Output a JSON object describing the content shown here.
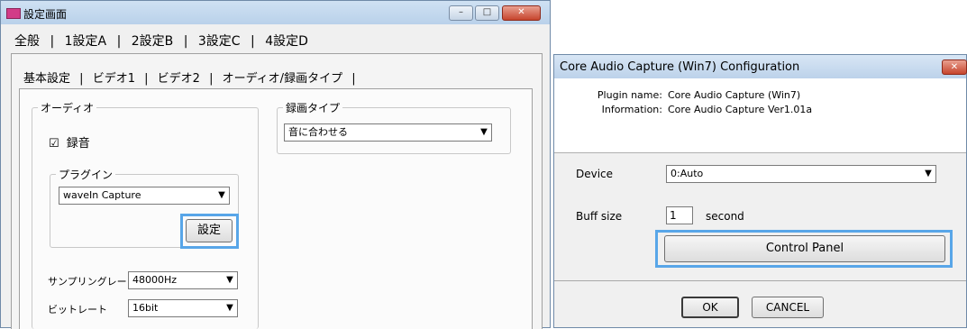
{
  "settings_window": {
    "title": "設定画面",
    "controls": {
      "minimize": "–",
      "maximize": "□",
      "close": "✕"
    },
    "top_tabs": [
      "全般",
      "1設定A",
      "2設定B",
      "3設定C",
      "4設定D"
    ],
    "top_tab_separators": [
      "|",
      "|",
      "|",
      "|"
    ],
    "sub_tabs": [
      "基本設定",
      "ビデオ1",
      "ビデオ2",
      "オーディオ/録画タイプ"
    ],
    "sub_tab_separators": [
      "|",
      "|",
      "|",
      "|"
    ],
    "audio_group": {
      "legend": "オーディオ",
      "record_checkbox": {
        "mark": "☑",
        "label": "録音",
        "checked": true
      },
      "plugin_group": {
        "legend": "プラグイン",
        "plugin_select": "waveIn Capture",
        "settings_button": "設定"
      },
      "sampling_rate_label": "サンプリングレート",
      "sampling_rate_value": "48000Hz",
      "bit_rate_label": "ビットレート",
      "bit_rate_value": "16bit"
    },
    "record_type_group": {
      "legend": "録画タイプ",
      "record_type_select": "音に合わせる"
    }
  },
  "config_dialog": {
    "title": "Core Audio Capture (Win7) Configuration",
    "close": "✕",
    "plugin_name_label": "Plugin name:",
    "plugin_name_value": "Core Audio Capture (Win7)",
    "information_label": "Information:",
    "information_value": "Core Audio Capture Ver1.01a",
    "device_label": "Device",
    "device_value": "0:Auto",
    "buff_size_label": "Buff size",
    "buff_size_value": "1",
    "buff_size_unit": "second",
    "control_panel_button": "Control Panel",
    "ok_button": "OK",
    "cancel_button": "CANCEL"
  },
  "icons": {
    "dropdown_arrow": "▼"
  },
  "colors": {
    "highlight": "#58a6e8",
    "title_gradient": "#bcd2ea",
    "app_icon": "#d23c88"
  }
}
